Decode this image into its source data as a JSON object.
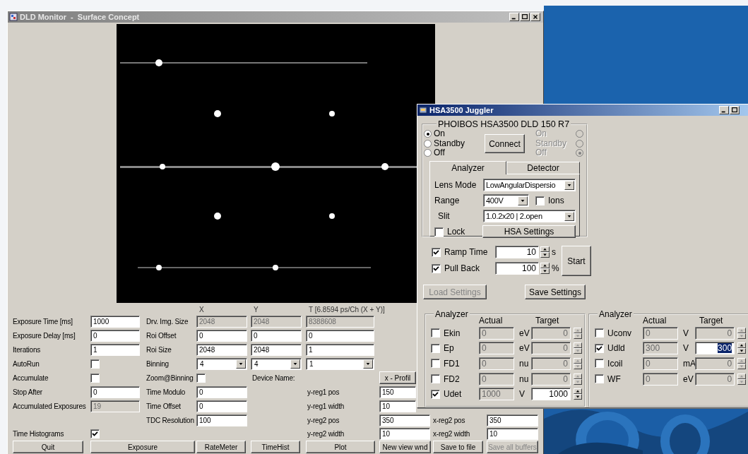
{
  "main_window": {
    "title": "DLD Monitor  -  Surface Concept",
    "column_headers": [
      "X",
      "Y",
      "T [6.8594 ps/Ch (X + Y)]"
    ],
    "exposure_fields": [
      {
        "kind": "text",
        "label": "Exposure Time [ms]",
        "value": "1000",
        "disabled": false
      },
      {
        "kind": "text",
        "label": "Exposure Delay [ms]",
        "value": "0",
        "disabled": false
      },
      {
        "kind": "text",
        "label": "Iterations",
        "value": "1",
        "disabled": false
      },
      {
        "kind": "check",
        "label": "AutoRun",
        "checked": false
      },
      {
        "kind": "check",
        "label": "Accumulate",
        "checked": false
      },
      {
        "kind": "text",
        "label": "Stop After",
        "value": "0",
        "disabled": false
      },
      {
        "kind": "text",
        "label": "Accumulated Exposures",
        "value": "19",
        "disabled": true
      }
    ],
    "time_histograms": {
      "label": "Time Histograms",
      "checked": true
    },
    "geometry_rows": [
      {
        "label": "Drv. Img. Size",
        "cells": [
          {
            "kind": "text",
            "value": "2048",
            "disabled": true
          },
          {
            "kind": "text",
            "value": "2048",
            "disabled": true
          },
          {
            "kind": "text",
            "value": "8388608",
            "disabled": true
          }
        ]
      },
      {
        "label": "Roi Offset",
        "cells": [
          {
            "kind": "text",
            "value": "0",
            "disabled": false
          },
          {
            "kind": "text",
            "value": "0",
            "disabled": false
          },
          {
            "kind": "text",
            "value": "0",
            "disabled": false
          }
        ]
      },
      {
        "label": "Roi Size",
        "cells": [
          {
            "kind": "text",
            "value": "2048",
            "disabled": false
          },
          {
            "kind": "text",
            "value": "2048",
            "disabled": false
          },
          {
            "kind": "text",
            "value": "1",
            "disabled": false
          }
        ]
      },
      {
        "label": "Binning",
        "cells": [
          {
            "kind": "select",
            "value": "4"
          },
          {
            "kind": "select",
            "value": "4"
          },
          {
            "kind": "select",
            "value": "1"
          }
        ]
      }
    ],
    "zoom_binning": {
      "label": "Zoom@Binning",
      "checked": false
    },
    "device_name_label": "Device Name:",
    "x_profile_button": "x - Profil",
    "timing_fields": [
      {
        "label": "Time Modulo",
        "value": "0"
      },
      {
        "label": "Time Offset",
        "value": "0"
      },
      {
        "label": "TDC Resolution",
        "value": "100"
      }
    ],
    "y_regions": [
      {
        "label": "y-reg1 pos",
        "value": "150"
      },
      {
        "label": "y-reg1 width",
        "value": "10"
      },
      {
        "label": "y-reg2 pos",
        "value": "350"
      },
      {
        "label": "y-reg2 width",
        "value": "10"
      }
    ],
    "x_regions": [
      {
        "label": "x-reg2 pos",
        "value": "350"
      },
      {
        "label": "x-reg2 width",
        "value": "10"
      }
    ],
    "buttons": [
      {
        "label": "Quit",
        "disabled": false
      },
      {
        "label": "Exposure",
        "disabled": false
      },
      {
        "label": "RateMeter",
        "disabled": false
      },
      {
        "label": "TimeHist",
        "disabled": false
      },
      {
        "label": "Plot",
        "disabled": false
      },
      {
        "label": "New view wnd",
        "disabled": false
      },
      {
        "label": "Save to file",
        "disabled": false
      },
      {
        "label": "Save all buffers",
        "disabled": true
      }
    ]
  },
  "hsa_window": {
    "title": "HSA3500 Juggler",
    "device_group": {
      "title": "PHOIBOS HSA3500 DLD 150 R7",
      "power_options": [
        {
          "label": "On",
          "selected": true
        },
        {
          "label": "Standby",
          "selected": false
        },
        {
          "label": "Off",
          "selected": false
        }
      ],
      "connect_button": "Connect",
      "remote_power": {
        "disabled": true,
        "options": [
          {
            "label": "On",
            "selected": false
          },
          {
            "label": "Standby",
            "selected": false
          },
          {
            "label": "Off",
            "selected": true
          }
        ]
      },
      "tabs": [
        {
          "label": "Analyzer",
          "selected": true
        },
        {
          "label": "Detector",
          "selected": false
        }
      ],
      "lens_mode": {
        "label": "Lens Mode",
        "value": "LowAngularDispersio"
      },
      "range": {
        "label": "Range",
        "value": "400V"
      },
      "ions": {
        "label": "Ions",
        "checked": false
      },
      "slit": {
        "label": "Slit",
        "value": "1.0.2x20 | 2.open"
      },
      "lock": {
        "label": "Lock",
        "checked": false
      },
      "hsa_settings_button": "HSA Settings"
    },
    "ramp_rows": [
      {
        "label": "Ramp Time",
        "checked": true,
        "value": "10",
        "unit": "s"
      },
      {
        "label": "Pull Back",
        "checked": true,
        "value": "100",
        "unit": "%"
      }
    ],
    "start_button": "Start",
    "settings_buttons": [
      {
        "label": "Load Settings",
        "disabled": true
      },
      {
        "label": "Save Settings",
        "disabled": false
      }
    ],
    "channel_groups": [
      {
        "title": "Analyzer",
        "headers": [
          "Actual",
          "Target"
        ],
        "channels": [
          {
            "label": "Ekin",
            "checked": false,
            "actual": "0",
            "unit": "eV",
            "target": "0",
            "highlighted": false
          },
          {
            "label": "Ep",
            "checked": false,
            "actual": "0",
            "unit": "eV",
            "target": "0",
            "highlighted": false
          },
          {
            "label": "FD1",
            "checked": false,
            "actual": "0",
            "unit": "nu",
            "target": "0",
            "highlighted": false
          },
          {
            "label": "FD2",
            "checked": false,
            "actual": "0",
            "unit": "nu",
            "target": "0",
            "highlighted": false
          },
          {
            "label": "Udet",
            "checked": true,
            "actual": "1000",
            "unit": "V",
            "target": "1000",
            "highlighted": false
          }
        ]
      },
      {
        "title": "Analyzer",
        "headers": [
          "Actual",
          "Target"
        ],
        "channels": [
          {
            "label": "Uconv",
            "checked": false,
            "actual": "0",
            "unit": "V",
            "target": "0",
            "highlighted": false
          },
          {
            "label": "Udld",
            "checked": true,
            "actual": "300",
            "unit": "V",
            "target": "300",
            "highlighted": true
          },
          {
            "label": "Icoil",
            "checked": false,
            "actual": "0",
            "unit": "mA",
            "target": "0",
            "highlighted": false
          },
          {
            "label": "WF",
            "checked": false,
            "actual": "0",
            "unit": "eV",
            "target": "0",
            "highlighted": false
          }
        ]
      }
    ]
  }
}
